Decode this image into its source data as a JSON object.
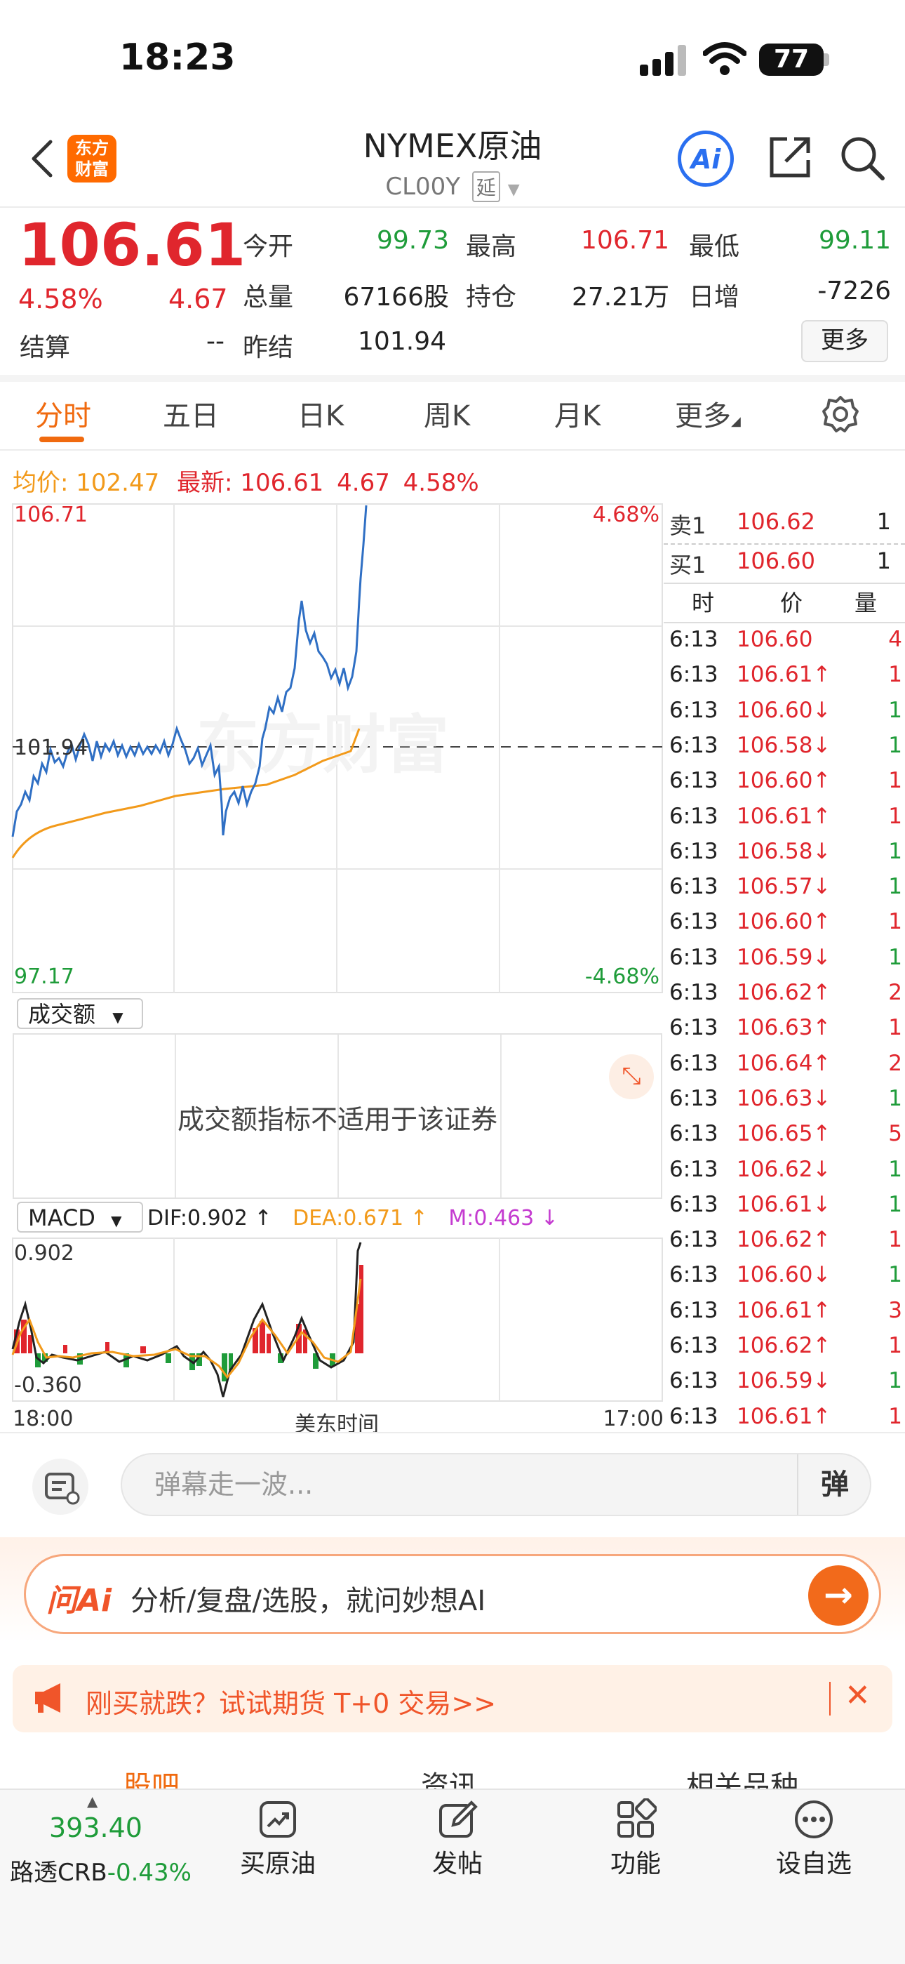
{
  "status": {
    "time": "18:23",
    "battery": "77"
  },
  "header": {
    "logo_line1": "东方",
    "logo_line2": "财富",
    "title": "NYMEX原油",
    "subtitle": "CL00Y",
    "delay_badge": "延",
    "ai_label": "Ai"
  },
  "quote": {
    "price": "106.61",
    "pct": "4.58%",
    "chg": "4.67",
    "open_label": "今开",
    "open": "99.73",
    "high_label": "最高",
    "high": "106.71",
    "low_label": "最低",
    "low": "99.11",
    "volume_label": "总量",
    "volume": "67166股",
    "oi_label": "持仓",
    "oi": "27.21万",
    "daily_inc_label": "日增",
    "daily_inc": "-7226",
    "settle_label": "结算",
    "settle": "--",
    "prev_settle_label": "昨结",
    "prev_settle": "101.94",
    "more": "更多"
  },
  "tabs": [
    "分时",
    "五日",
    "日K",
    "周K",
    "月K",
    "更多"
  ],
  "chart": {
    "avg_label": "均价:",
    "avg": "102.47",
    "latest_label": "最新:",
    "latest": "106.61",
    "latest_chg": "4.67",
    "latest_pct": "4.58%",
    "y_top": "106.71",
    "y_mid": "101.94",
    "y_bottom": "97.17",
    "pct_top": "4.68%",
    "pct_bottom": "-4.68%",
    "watermark": "东方财富",
    "vol_selector": "成交额",
    "vol_notice": "成交额指标不适用于该证券",
    "macd_selector": "MACD",
    "dif": "DIF:0.902 ↑",
    "dea": "DEA:0.671 ↑",
    "m": "M:0.463 ↓",
    "macd_top": "0.902",
    "macd_bottom": "-0.360",
    "x_start": "18:00",
    "x_mid": "美东时间",
    "x_end": "17:00"
  },
  "order_book": {
    "sell_label": "卖1",
    "sell_price": "106.62",
    "sell_qty": "1",
    "buy_label": "买1",
    "buy_price": "106.60",
    "buy_qty": "1",
    "col_time": "时",
    "col_price": "价",
    "col_qty": "量",
    "ticks": [
      {
        "t": "6:13",
        "p": "106.60",
        "q": "4",
        "d": ""
      },
      {
        "t": "6:13",
        "p": "106.61↑",
        "q": "1",
        "d": "up"
      },
      {
        "t": "6:13",
        "p": "106.60↓",
        "q": "1",
        "d": "down"
      },
      {
        "t": "6:13",
        "p": "106.58↓",
        "q": "1",
        "d": "down"
      },
      {
        "t": "6:13",
        "p": "106.60↑",
        "q": "1",
        "d": "up"
      },
      {
        "t": "6:13",
        "p": "106.61↑",
        "q": "1",
        "d": "up"
      },
      {
        "t": "6:13",
        "p": "106.58↓",
        "q": "1",
        "d": "down"
      },
      {
        "t": "6:13",
        "p": "106.57↓",
        "q": "1",
        "d": "down"
      },
      {
        "t": "6:13",
        "p": "106.60↑",
        "q": "1",
        "d": "up"
      },
      {
        "t": "6:13",
        "p": "106.59↓",
        "q": "1",
        "d": "down"
      },
      {
        "t": "6:13",
        "p": "106.62↑",
        "q": "2",
        "d": "up"
      },
      {
        "t": "6:13",
        "p": "106.63↑",
        "q": "1",
        "d": "up"
      },
      {
        "t": "6:13",
        "p": "106.64↑",
        "q": "2",
        "d": "up"
      },
      {
        "t": "6:13",
        "p": "106.63↓",
        "q": "1",
        "d": "down"
      },
      {
        "t": "6:13",
        "p": "106.65↑",
        "q": "5",
        "d": "up"
      },
      {
        "t": "6:13",
        "p": "106.62↓",
        "q": "1",
        "d": "down"
      },
      {
        "t": "6:13",
        "p": "106.61↓",
        "q": "1",
        "d": "down"
      },
      {
        "t": "6:13",
        "p": "106.62↑",
        "q": "1",
        "d": "up"
      },
      {
        "t": "6:13",
        "p": "106.60↓",
        "q": "1",
        "d": "down"
      },
      {
        "t": "6:13",
        "p": "106.61↑",
        "q": "3",
        "d": "up"
      },
      {
        "t": "6:13",
        "p": "106.62↑",
        "q": "1",
        "d": "up"
      },
      {
        "t": "6:13",
        "p": "106.59↓",
        "q": "1",
        "d": "down"
      },
      {
        "t": "6:13",
        "p": "106.61↑",
        "q": "1",
        "d": "up"
      }
    ]
  },
  "danmu": {
    "placeholder": "弹幕走一波...",
    "button": "弹"
  },
  "ai_bar": {
    "logo": "问Ai",
    "text": "分析/复盘/选股，就问妙想AI"
  },
  "promo": {
    "text": "刚买就跌？试试期货 T+0 交易>>"
  },
  "sub_tabs": [
    "股吧",
    "资讯",
    "相关品种"
  ],
  "bottom_nav": {
    "crb_value": "393.40",
    "crb_label": "路透CRB",
    "crb_pct": "-0.43%",
    "items": [
      "买原油",
      "发帖",
      "功能",
      "设自选"
    ]
  }
}
